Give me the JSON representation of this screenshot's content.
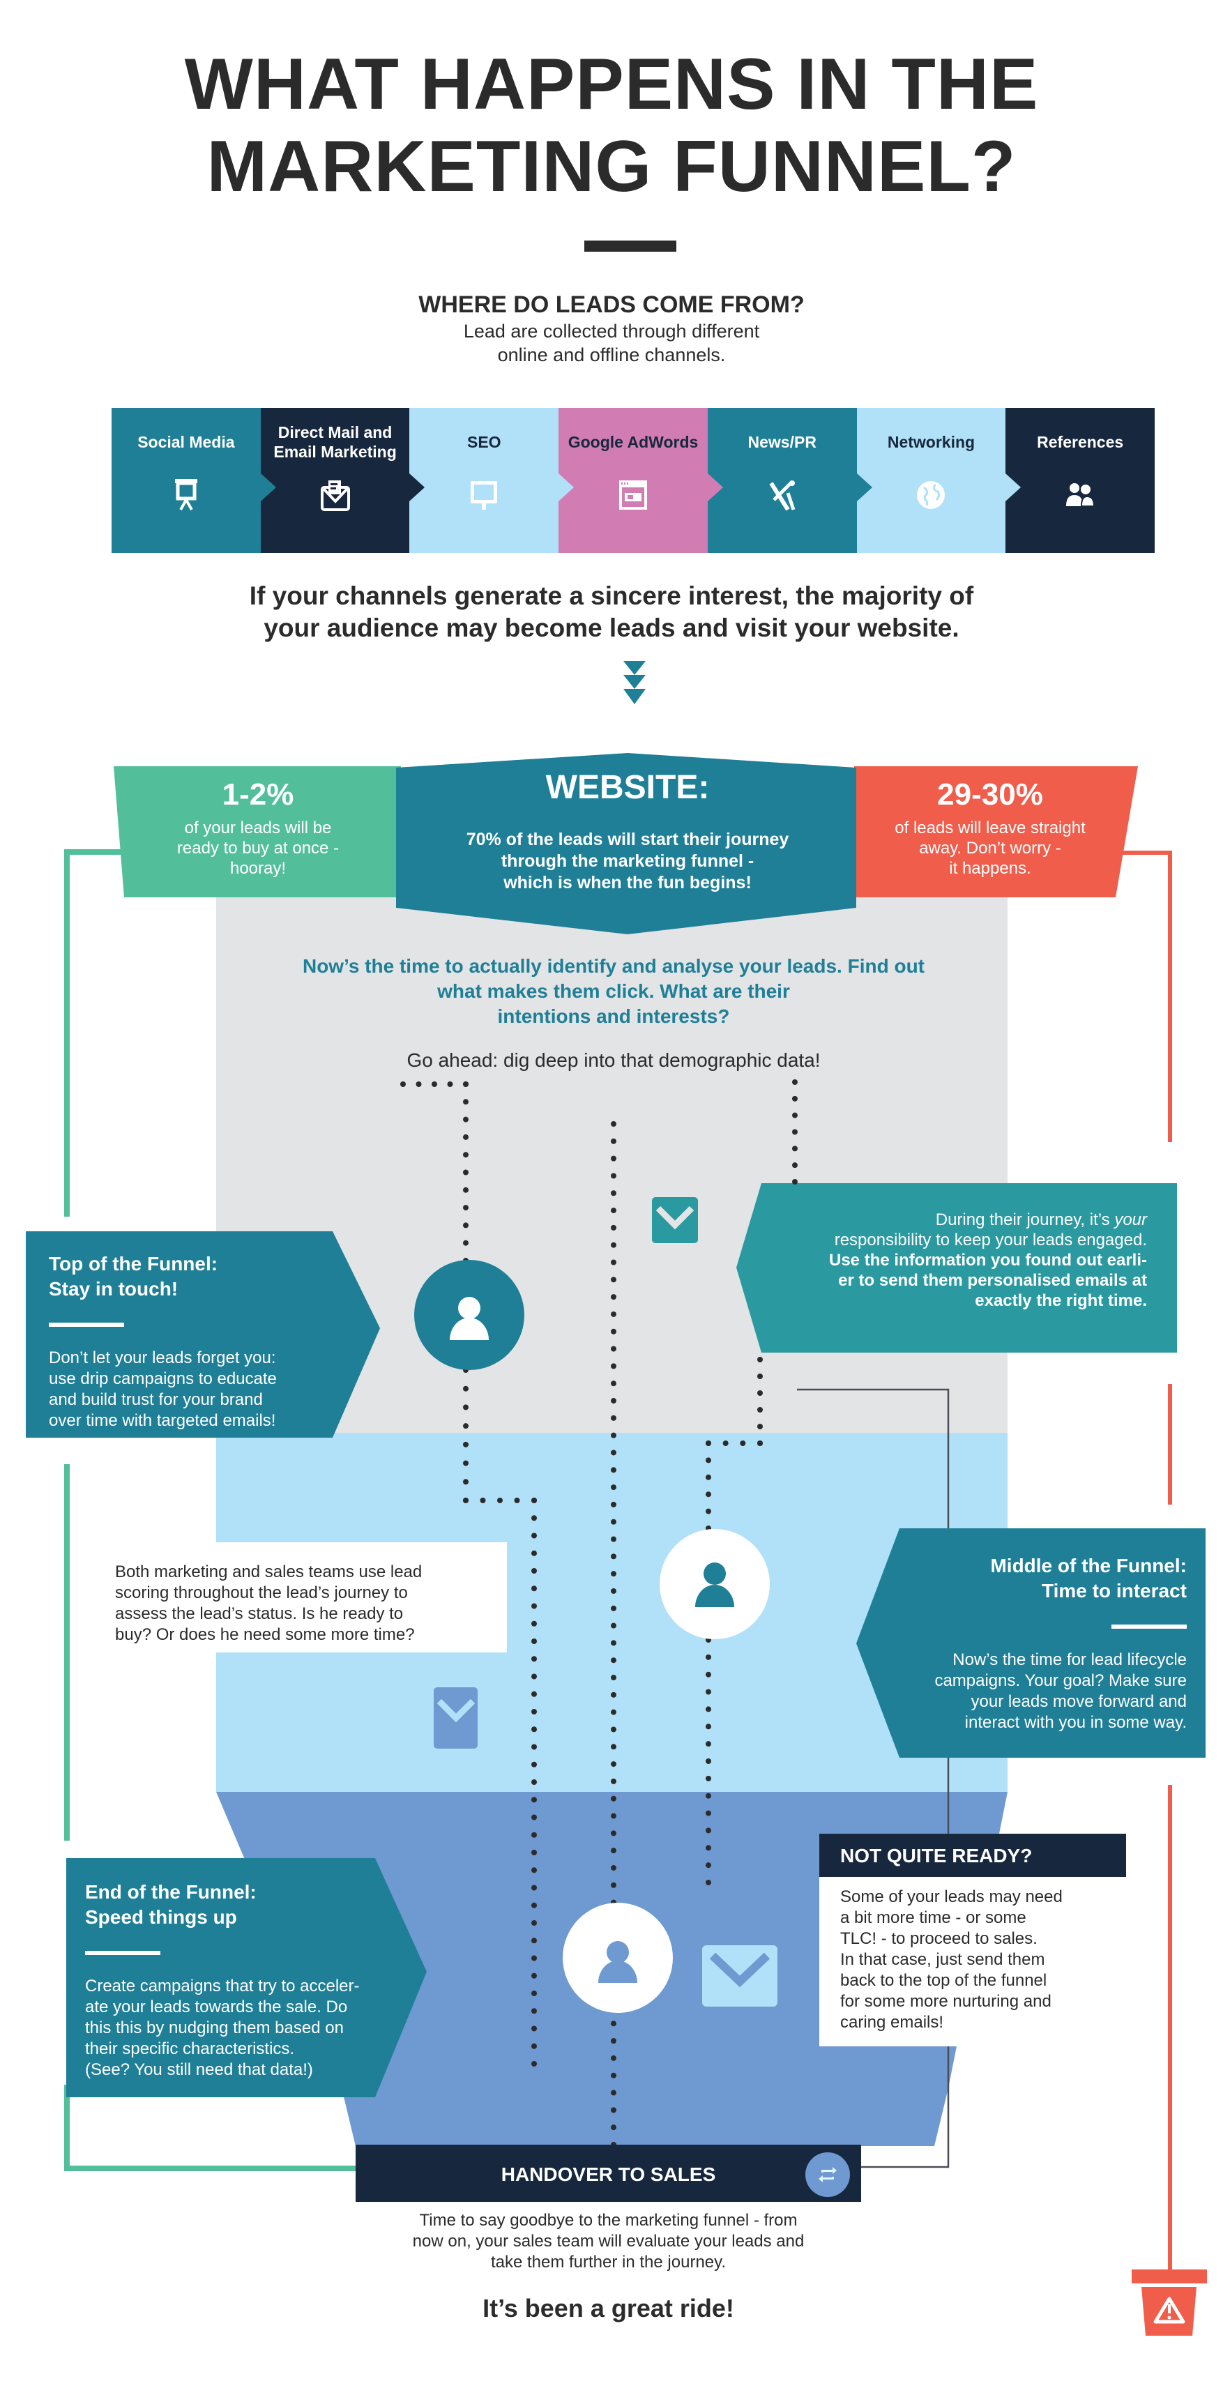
{
  "header": {
    "title_line1": "WHAT HAPPENS IN THE",
    "title_line2": "MARKETING FUNNEL?",
    "sources_heading": "WHERE DO LEADS COME FROM?",
    "sources_sub_line1": "Lead are collected through different",
    "sources_sub_line2": "online and offline channels."
  },
  "channels": [
    {
      "label": "Social Media",
      "icon": "presentation-board-icon",
      "color": "#1e7f97",
      "text_color": "#ffffff"
    },
    {
      "label": "Direct Mail and Email Marketing",
      "icon": "mail-envelope-icon",
      "color": "#17273d",
      "text_color": "#ffffff"
    },
    {
      "label": "SEO",
      "icon": "monitor-icon",
      "color": "#b1e1f8",
      "text_color": "#17273d"
    },
    {
      "label": "Google AdWords",
      "icon": "ad-window-icon",
      "color": "#d17db4",
      "text_color": "#17273d"
    },
    {
      "label": "News/PR",
      "icon": "satellite-dish-icon",
      "color": "#1e7f97",
      "text_color": "#ffffff"
    },
    {
      "label": "Networking",
      "icon": "globe-icon",
      "color": "#b1e1f8",
      "text_color": "#17273d"
    },
    {
      "label": "References",
      "icon": "people-icon",
      "color": "#17273d",
      "text_color": "#ffffff"
    }
  ],
  "statement": {
    "line1": "If your channels generate a sincere interest, the majority of",
    "line2": "your audience may become leads and visit your website."
  },
  "stats": {
    "left": {
      "value": "1-2%",
      "text_line1": "of your leads will be",
      "text_line2": "ready to buy at once -",
      "text_line3": "hooray!",
      "color": "#52bf9a"
    },
    "website": {
      "title": "WEBSITE:",
      "text_line1": "70% of the leads will start their journey",
      "text_line2": "through the marketing funnel -",
      "text_line3": "which is when the fun begins!",
      "color": "#1e7f97"
    },
    "right": {
      "value": "29-30%",
      "text_line1": "of leads will leave straight",
      "text_line2": "away. Don’t worry -",
      "text_line3": "it happens.",
      "color": "#f05d4b"
    }
  },
  "identify": {
    "line1": "Now’s the time to actually identify and analyse your leads. Find out",
    "line2": "what makes them click. What are their",
    "line3": "intentions and interests?",
    "dig_deep": "Go ahead: dig deep into that demographic data!"
  },
  "top_of_funnel": {
    "heading_line1": "Top of the Funnel:",
    "heading_line2": "Stay in touch!",
    "body_line1": "Don’t let your leads forget you:",
    "body_line2": "use drip campaigns to educate",
    "body_line3": "and build trust for your brand",
    "body_line4": "over time with targeted emails!"
  },
  "engage": {
    "line1_prefix": "During their journey, it’s ",
    "line1_emph": "your",
    "line2": "responsibility to keep your leads engaged.",
    "bold_line1": "Use the information you found out earli-",
    "bold_line2": "er to send them personalised emails at",
    "bold_line3": "exactly the right time."
  },
  "scoring": {
    "line1": "Both marketing and sales teams use lead",
    "line2": "scoring throughout the lead’s journey to",
    "line3": "assess the lead’s status. Is he ready to",
    "line4": "buy? Or does he need some more time?"
  },
  "middle_of_funnel": {
    "heading_line1": "Middle of the Funnel:",
    "heading_line2": "Time to interact",
    "body_line1": "Now’s the time for lead lifecycle",
    "body_line2": "campaigns. Your goal? Make sure",
    "body_line3": "your leads move forward and",
    "body_line4": "interact with you in some way."
  },
  "end_of_funnel": {
    "heading_line1": "End of the Funnel:",
    "heading_line2": "Speed things up",
    "body_line1": "Create campaigns that try to acceler-",
    "body_line2": "ate your leads towards the sale. Do",
    "body_line3": "this this by nudging them based on",
    "body_line4": "their specific characteristics.",
    "body_line5": "(See? You still need that data!)"
  },
  "not_quite_ready": {
    "heading": "NOT QUITE READY?",
    "line1": "Some of your leads may need",
    "line2": "a bit more time - or some",
    "line3": "TLC! - to proceed to sales.",
    "line4": "In that case, just send them",
    "line5": "back to the top of the funnel",
    "line6": "for some more nurturing and",
    "line7": "caring emails!"
  },
  "handover": {
    "label": "HANDOVER TO SALES",
    "icon": "repeat-arrows-icon",
    "goodbye_line1": "Time to say goodbye to the marketing funnel - from",
    "goodbye_line2": "now on, your sales team will evaluate your leads and",
    "goodbye_line3": "take them further in the journey.",
    "closing": "It’s been a great ride!"
  },
  "colors": {
    "teal": "#1e7f97",
    "teal_light": "#2a9aa0",
    "navy": "#17273d",
    "green": "#52bf9a",
    "red": "#f05d4b",
    "gray_zone": "#e3e4e6",
    "lightblue_zone": "#b1e1f8",
    "blue_zone": "#6f99d1",
    "pink": "#d17db4"
  }
}
